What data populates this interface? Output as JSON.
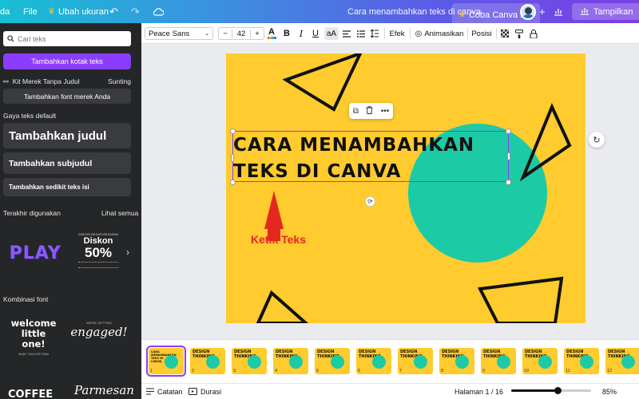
{
  "topbar": {
    "menu_partial": "da",
    "file_label": "File",
    "resize_label": "Ubah ukuran",
    "doc_title": "Cara menambahkan teks di canva",
    "pro_label": "Coba Canva Pro",
    "share_label": "Tampilkan"
  },
  "panel": {
    "search_placeholder": "Cari teks",
    "add_textbox_label": "Tambahkan kotak teks",
    "brand_kit_label": "Kit Merek Tanpa Judul",
    "brand_kit_edit": "Sunting",
    "add_brand_font": "Tambahkan font merek Anda",
    "default_styles_label": "Gaya teks default",
    "heading_label": "Tambahkan judul",
    "subheading_label": "Tambahkan subjudul",
    "body_label": "Tambahkan sedikit teks isi",
    "recent_label": "Terakhir digunakan",
    "see_all_label": "Lihat semua",
    "recent_play": "PLAY",
    "recent_discount_top": "DISKON BESAR-BESARAN",
    "recent_discount_word": "Diskon",
    "recent_discount_pct": "50%",
    "font_combos_label": "Kombinasi font",
    "combo_welcome": "welcome little one!",
    "combo_welcome_sub": "BABY TAYLOR FINN",
    "combo_engaged_top": "WE'RE GETTING",
    "combo_engaged": "engaged!",
    "combo_coffee": "COFFEE",
    "combo_parmesan": "Parmesan"
  },
  "toolbar": {
    "font_name": "Peace Sans",
    "font_size": "42",
    "minus": "−",
    "plus": "+",
    "color_letter": "A",
    "bold": "B",
    "italic": "I",
    "underline": "U",
    "case": "aA",
    "effects_label": "Efek",
    "animate_label": "Animasikan",
    "position_label": "Posisi"
  },
  "canvas": {
    "title_line1": "CARA MENAMBAHKAN",
    "title_line2": "TEKS DI CANVA",
    "annotation": "Ketik Teks",
    "page_color": "#ffcb2e",
    "circle_color": "#1ccaa6",
    "annotation_color": "#e5281f"
  },
  "thumbnails": {
    "label_line1": "DESIGN",
    "label_line2": "THINKING",
    "first_title": "CARA MENAMBAHKAN TEKS DI CANVA",
    "numbers": [
      "1",
      "2",
      "3",
      "4",
      "5",
      "6",
      "7",
      "8",
      "9",
      "10",
      "11",
      "12"
    ]
  },
  "bottombar": {
    "notes_label": "Catatan",
    "duration_label": "Durasi",
    "page_indicator": "Halaman 1 / 16",
    "zoom_label": "85%",
    "zoom_level": 0.58
  },
  "colors": {
    "accent": "#8b3dff",
    "panel_bg": "#252627"
  }
}
